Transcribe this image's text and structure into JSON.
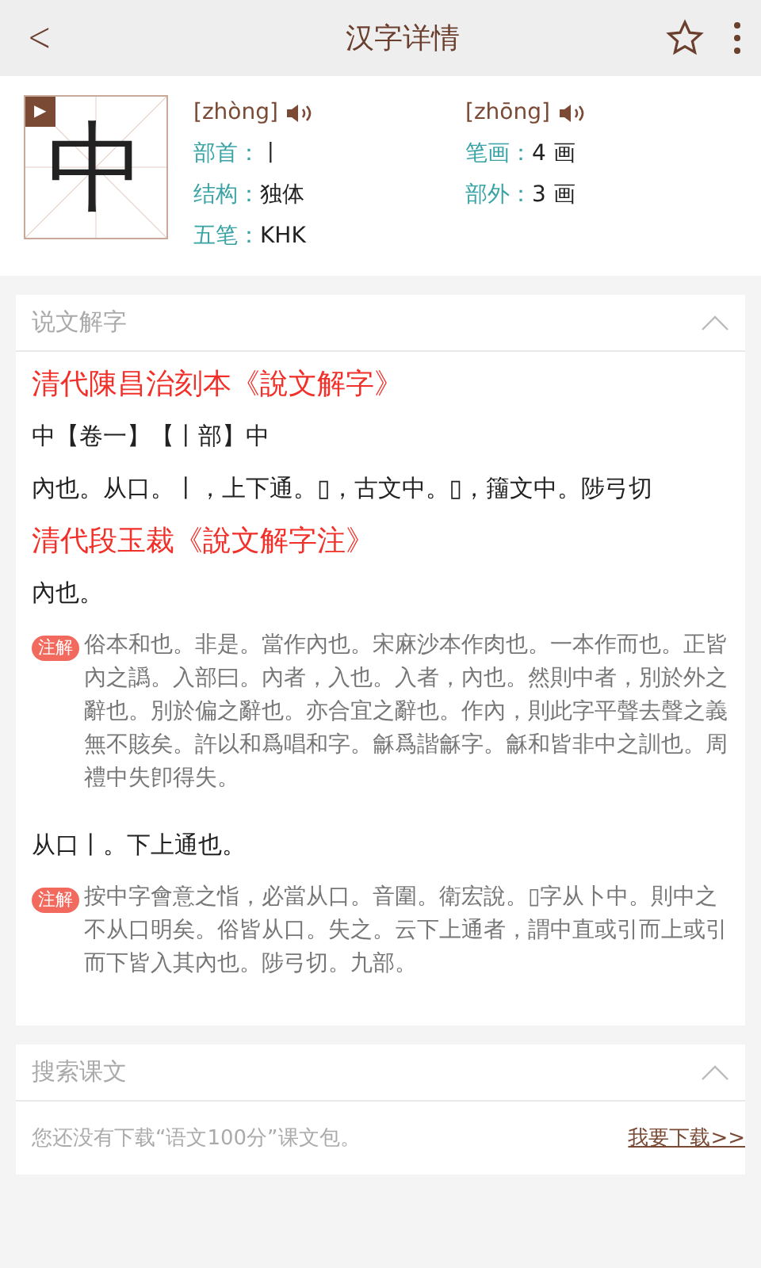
{
  "header": {
    "back": "<",
    "title": "汉字详情",
    "favorite": false
  },
  "character": {
    "glyph": "中",
    "play": "▶"
  },
  "pinyin": [
    {
      "text": "[zhòng]"
    },
    {
      "text": "[zhōng]"
    }
  ],
  "info": [
    {
      "label": "部首：",
      "value": "丨"
    },
    {
      "label": "笔画：",
      "value": "4 画"
    },
    {
      "label": "结构：",
      "value": "独体"
    },
    {
      "label": "部外：",
      "value": "3 画"
    },
    {
      "label": "五笔：",
      "value": "KHK"
    }
  ],
  "shuowen": {
    "title": "说文解字",
    "expanded": true,
    "blocks": [
      {
        "kind": "source",
        "text": "清代陳昌治刻本《說文解字》"
      },
      {
        "kind": "plain",
        "text": "中【卷一】【丨部】中"
      },
      {
        "kind": "plain",
        "text": "內也。从口。丨，上下通。▯，古文中。▯，籒文中。陟弓切"
      },
      {
        "kind": "source",
        "text": "清代段玉裁《說文解字注》"
      },
      {
        "kind": "plain",
        "text": "內也。"
      },
      {
        "kind": "note",
        "badge": "注解",
        "text": "俗本和也。非是。當作內也。宋麻沙本作肉也。一本作而也。正皆內之譌。入部曰。內者，入也。入者，內也。然則中者，別於外之辭也。別於偏之辭也。亦合宜之辭也。作內，則此字平聲去聲之義無不賅矣。許以和爲唱和字。龢爲諧龢字。龢和皆非中之訓也。周禮中失卽得失。"
      },
      {
        "kind": "plain",
        "text": "从口丨。下上通也。"
      },
      {
        "kind": "note",
        "badge": "注解",
        "text": "按中字會意之恉，必當从口。音圍。衛宏說。▯字从卜中。則中之不从口明矣。俗皆从口。失之。云下上通者，謂中直或引而上或引而下皆入其內也。陟弓切。九部。"
      }
    ]
  },
  "texts": {
    "title": "搜索课文",
    "expanded": true,
    "message": "您还没有下载“语文100分”课文包。",
    "link": "我要下载>>"
  }
}
